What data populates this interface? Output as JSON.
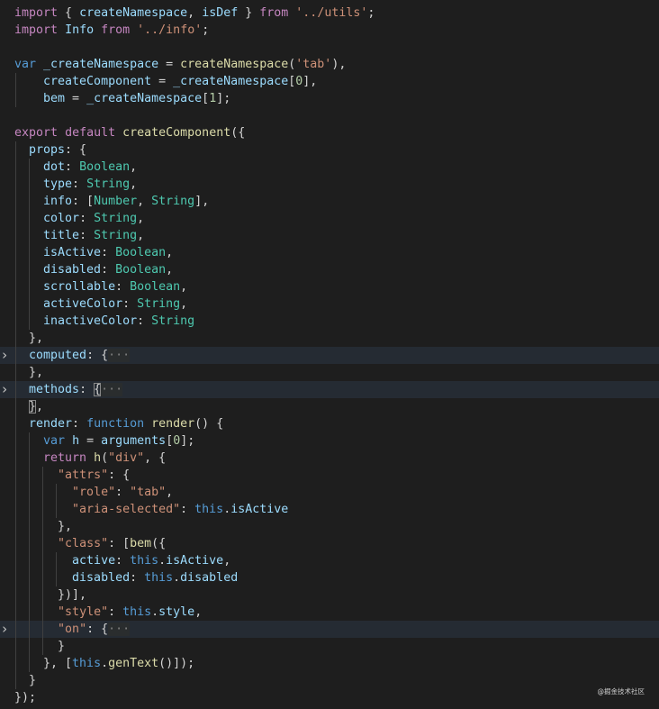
{
  "theme": {
    "background": "#1e1e1e",
    "foreground": "#d4d4d4",
    "keyword_control": "#c586c0",
    "keyword_storage": "#569cd6",
    "variable": "#9cdcfe",
    "function": "#dcdcaa",
    "type": "#4ec9b0",
    "string": "#ce9178",
    "number": "#b5cea8",
    "punctuation": "#d4d4d4"
  },
  "lines": [
    {
      "tokens": [
        {
          "t": "import",
          "c": "kc"
        },
        {
          "t": " { ",
          "c": "p"
        },
        {
          "t": "createNamespace",
          "c": "v"
        },
        {
          "t": ", ",
          "c": "p"
        },
        {
          "t": "isDef",
          "c": "v"
        },
        {
          "t": " } ",
          "c": "p"
        },
        {
          "t": "from",
          "c": "kc"
        },
        {
          "t": " ",
          "c": "p"
        },
        {
          "t": "'../utils'",
          "c": "s"
        },
        {
          "t": ";",
          "c": "p"
        }
      ]
    },
    {
      "tokens": [
        {
          "t": "import",
          "c": "kc"
        },
        {
          "t": " ",
          "c": "p"
        },
        {
          "t": "Info",
          "c": "v"
        },
        {
          "t": " ",
          "c": "p"
        },
        {
          "t": "from",
          "c": "kc"
        },
        {
          "t": " ",
          "c": "p"
        },
        {
          "t": "'../info'",
          "c": "s"
        },
        {
          "t": ";",
          "c": "p"
        }
      ]
    },
    {
      "tokens": []
    },
    {
      "tokens": [
        {
          "t": "var",
          "c": "k"
        },
        {
          "t": " ",
          "c": "p"
        },
        {
          "t": "_createNamespace",
          "c": "v"
        },
        {
          "t": " = ",
          "c": "p"
        },
        {
          "t": "createNamespace",
          "c": "f"
        },
        {
          "t": "(",
          "c": "p"
        },
        {
          "t": "'tab'",
          "c": "s"
        },
        {
          "t": "),",
          "c": "p"
        }
      ]
    },
    {
      "indent": 1,
      "tokens": [
        {
          "t": "    createComponent",
          "c": "v"
        },
        {
          "t": " = ",
          "c": "p"
        },
        {
          "t": "_createNamespace",
          "c": "v"
        },
        {
          "t": "[",
          "c": "p"
        },
        {
          "t": "0",
          "c": "n"
        },
        {
          "t": "],",
          "c": "p"
        }
      ]
    },
    {
      "indent": 1,
      "tokens": [
        {
          "t": "    bem",
          "c": "v"
        },
        {
          "t": " = ",
          "c": "p"
        },
        {
          "t": "_createNamespace",
          "c": "v"
        },
        {
          "t": "[",
          "c": "p"
        },
        {
          "t": "1",
          "c": "n"
        },
        {
          "t": "];",
          "c": "p"
        }
      ]
    },
    {
      "tokens": []
    },
    {
      "tokens": [
        {
          "t": "export",
          "c": "kc"
        },
        {
          "t": " ",
          "c": "p"
        },
        {
          "t": "default",
          "c": "kc"
        },
        {
          "t": " ",
          "c": "p"
        },
        {
          "t": "createComponent",
          "c": "f"
        },
        {
          "t": "({",
          "c": "p"
        }
      ]
    },
    {
      "indent": 1,
      "tokens": [
        {
          "t": "  props",
          "c": "v"
        },
        {
          "t": ": {",
          "c": "p"
        }
      ]
    },
    {
      "indent": 2,
      "tokens": [
        {
          "t": "    dot",
          "c": "v"
        },
        {
          "t": ": ",
          "c": "p"
        },
        {
          "t": "Boolean",
          "c": "ty"
        },
        {
          "t": ",",
          "c": "p"
        }
      ]
    },
    {
      "indent": 2,
      "tokens": [
        {
          "t": "    type",
          "c": "v"
        },
        {
          "t": ": ",
          "c": "p"
        },
        {
          "t": "String",
          "c": "ty"
        },
        {
          "t": ",",
          "c": "p"
        }
      ]
    },
    {
      "indent": 2,
      "tokens": [
        {
          "t": "    info",
          "c": "v"
        },
        {
          "t": ": [",
          "c": "p"
        },
        {
          "t": "Number",
          "c": "ty"
        },
        {
          "t": ", ",
          "c": "p"
        },
        {
          "t": "String",
          "c": "ty"
        },
        {
          "t": "],",
          "c": "p"
        }
      ]
    },
    {
      "indent": 2,
      "tokens": [
        {
          "t": "    color",
          "c": "v"
        },
        {
          "t": ": ",
          "c": "p"
        },
        {
          "t": "String",
          "c": "ty"
        },
        {
          "t": ",",
          "c": "p"
        }
      ]
    },
    {
      "indent": 2,
      "tokens": [
        {
          "t": "    title",
          "c": "v"
        },
        {
          "t": ": ",
          "c": "p"
        },
        {
          "t": "String",
          "c": "ty"
        },
        {
          "t": ",",
          "c": "p"
        }
      ]
    },
    {
      "indent": 2,
      "tokens": [
        {
          "t": "    isActive",
          "c": "v"
        },
        {
          "t": ": ",
          "c": "p"
        },
        {
          "t": "Boolean",
          "c": "ty"
        },
        {
          "t": ",",
          "c": "p"
        }
      ]
    },
    {
      "indent": 2,
      "tokens": [
        {
          "t": "    disabled",
          "c": "v"
        },
        {
          "t": ": ",
          "c": "p"
        },
        {
          "t": "Boolean",
          "c": "ty"
        },
        {
          "t": ",",
          "c": "p"
        }
      ]
    },
    {
      "indent": 2,
      "tokens": [
        {
          "t": "    scrollable",
          "c": "v"
        },
        {
          "t": ": ",
          "c": "p"
        },
        {
          "t": "Boolean",
          "c": "ty"
        },
        {
          "t": ",",
          "c": "p"
        }
      ]
    },
    {
      "indent": 2,
      "tokens": [
        {
          "t": "    activeColor",
          "c": "v"
        },
        {
          "t": ": ",
          "c": "p"
        },
        {
          "t": "String",
          "c": "ty"
        },
        {
          "t": ",",
          "c": "p"
        }
      ]
    },
    {
      "indent": 2,
      "tokens": [
        {
          "t": "    inactiveColor",
          "c": "v"
        },
        {
          "t": ": ",
          "c": "p"
        },
        {
          "t": "String",
          "c": "ty"
        }
      ]
    },
    {
      "indent": 1,
      "tokens": [
        {
          "t": "  },",
          "c": "p"
        }
      ]
    },
    {
      "indent": 1,
      "fold": true,
      "hl": true,
      "tokens": [
        {
          "t": "  computed",
          "c": "v"
        },
        {
          "t": ": {",
          "c": "p"
        },
        {
          "t": "···",
          "c": "fb"
        }
      ]
    },
    {
      "indent": 1,
      "tokens": [
        {
          "t": "  },",
          "c": "p"
        }
      ]
    },
    {
      "indent": 1,
      "fold": true,
      "hl": true,
      "tokens": [
        {
          "t": "  methods",
          "c": "v"
        },
        {
          "t": ": ",
          "c": "p"
        },
        {
          "t": "{",
          "c": "bb"
        },
        {
          "t": "···",
          "c": "fb"
        }
      ]
    },
    {
      "indent": 1,
      "tokens": [
        {
          "t": "  ",
          "c": "p"
        },
        {
          "t": "}",
          "c": "bb"
        },
        {
          "t": ",",
          "c": "p"
        }
      ]
    },
    {
      "indent": 1,
      "tokens": [
        {
          "t": "  render",
          "c": "v"
        },
        {
          "t": ": ",
          "c": "p"
        },
        {
          "t": "function",
          "c": "k"
        },
        {
          "t": " ",
          "c": "p"
        },
        {
          "t": "render",
          "c": "f"
        },
        {
          "t": "() {",
          "c": "p"
        }
      ]
    },
    {
      "indent": 2,
      "tokens": [
        {
          "t": "    ",
          "c": "p"
        },
        {
          "t": "var",
          "c": "k"
        },
        {
          "t": " ",
          "c": "p"
        },
        {
          "t": "h",
          "c": "v"
        },
        {
          "t": " = ",
          "c": "p"
        },
        {
          "t": "arguments",
          "c": "v"
        },
        {
          "t": "[",
          "c": "p"
        },
        {
          "t": "0",
          "c": "n"
        },
        {
          "t": "];",
          "c": "p"
        }
      ]
    },
    {
      "indent": 2,
      "tokens": [
        {
          "t": "    ",
          "c": "p"
        },
        {
          "t": "return",
          "c": "kc"
        },
        {
          "t": " ",
          "c": "p"
        },
        {
          "t": "h",
          "c": "f"
        },
        {
          "t": "(",
          "c": "p"
        },
        {
          "t": "\"div\"",
          "c": "s"
        },
        {
          "t": ", {",
          "c": "p"
        }
      ]
    },
    {
      "indent": 3,
      "tokens": [
        {
          "t": "      ",
          "c": "p"
        },
        {
          "t": "\"attrs\"",
          "c": "s"
        },
        {
          "t": ": {",
          "c": "p"
        }
      ]
    },
    {
      "indent": 4,
      "tokens": [
        {
          "t": "        ",
          "c": "p"
        },
        {
          "t": "\"role\"",
          "c": "s"
        },
        {
          "t": ": ",
          "c": "p"
        },
        {
          "t": "\"tab\"",
          "c": "s"
        },
        {
          "t": ",",
          "c": "p"
        }
      ]
    },
    {
      "indent": 4,
      "tokens": [
        {
          "t": "        ",
          "c": "p"
        },
        {
          "t": "\"aria-selected\"",
          "c": "s"
        },
        {
          "t": ": ",
          "c": "p"
        },
        {
          "t": "this",
          "c": "k"
        },
        {
          "t": ".",
          "c": "p"
        },
        {
          "t": "isActive",
          "c": "v"
        }
      ]
    },
    {
      "indent": 3,
      "tokens": [
        {
          "t": "      },",
          "c": "p"
        }
      ]
    },
    {
      "indent": 3,
      "tokens": [
        {
          "t": "      ",
          "c": "p"
        },
        {
          "t": "\"class\"",
          "c": "s"
        },
        {
          "t": ": [",
          "c": "p"
        },
        {
          "t": "bem",
          "c": "f"
        },
        {
          "t": "({",
          "c": "p"
        }
      ]
    },
    {
      "indent": 4,
      "tokens": [
        {
          "t": "        active",
          "c": "v"
        },
        {
          "t": ": ",
          "c": "p"
        },
        {
          "t": "this",
          "c": "k"
        },
        {
          "t": ".",
          "c": "p"
        },
        {
          "t": "isActive",
          "c": "v"
        },
        {
          "t": ",",
          "c": "p"
        }
      ]
    },
    {
      "indent": 4,
      "tokens": [
        {
          "t": "        disabled",
          "c": "v"
        },
        {
          "t": ": ",
          "c": "p"
        },
        {
          "t": "this",
          "c": "k"
        },
        {
          "t": ".",
          "c": "p"
        },
        {
          "t": "disabled",
          "c": "v"
        }
      ]
    },
    {
      "indent": 3,
      "tokens": [
        {
          "t": "      })],",
          "c": "p"
        }
      ]
    },
    {
      "indent": 3,
      "tokens": [
        {
          "t": "      ",
          "c": "p"
        },
        {
          "t": "\"style\"",
          "c": "s"
        },
        {
          "t": ": ",
          "c": "p"
        },
        {
          "t": "this",
          "c": "k"
        },
        {
          "t": ".",
          "c": "p"
        },
        {
          "t": "style",
          "c": "v"
        },
        {
          "t": ",",
          "c": "p"
        }
      ]
    },
    {
      "indent": 3,
      "fold": true,
      "hl": true,
      "tokens": [
        {
          "t": "      ",
          "c": "p"
        },
        {
          "t": "\"on\"",
          "c": "s"
        },
        {
          "t": ": {",
          "c": "p"
        },
        {
          "t": "···",
          "c": "fb"
        }
      ]
    },
    {
      "indent": 3,
      "tokens": [
        {
          "t": "      }",
          "c": "p"
        }
      ]
    },
    {
      "indent": 2,
      "tokens": [
        {
          "t": "    }, [",
          "c": "p"
        },
        {
          "t": "this",
          "c": "k"
        },
        {
          "t": ".",
          "c": "p"
        },
        {
          "t": "genText",
          "c": "f"
        },
        {
          "t": "()]);",
          "c": "p"
        }
      ]
    },
    {
      "indent": 1,
      "tokens": [
        {
          "t": "  }",
          "c": "p"
        }
      ]
    },
    {
      "tokens": [
        {
          "t": "});",
          "c": "p"
        }
      ]
    }
  ],
  "fold_icon": "chevron-right-icon",
  "watermark": "@掘金技术社区"
}
